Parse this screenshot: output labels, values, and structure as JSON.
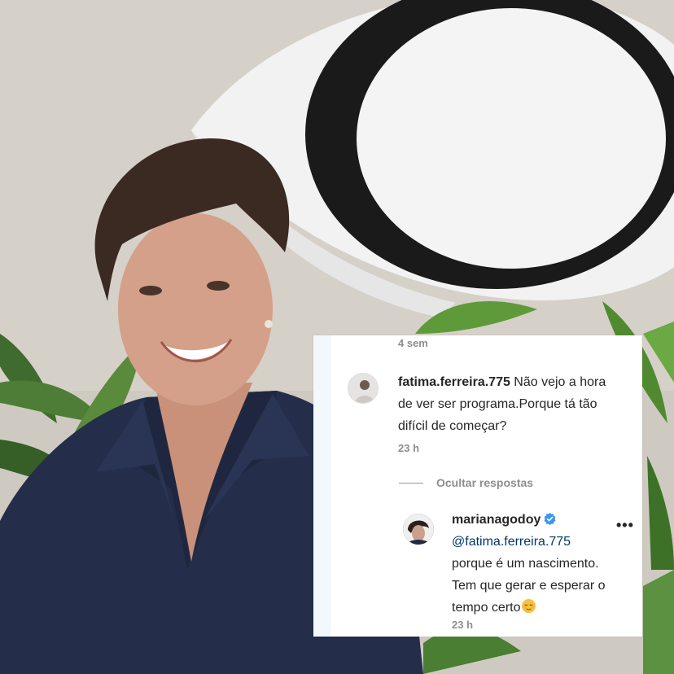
{
  "comments": {
    "top_timestamp": "4 sem",
    "first": {
      "username": "fatima.ferreira.775",
      "text": " Não vejo a hora de ver ser programa.Porque tá tão difícil de começar?",
      "timestamp": "23 h"
    },
    "hide_replies_label": "Ocultar respostas",
    "reply": {
      "username": "marianagodoy",
      "mention": "@fatima.ferreira.775",
      "text": "porque é um nascimento. Tem que gerar e esperar o tempo certo",
      "emoji": "relieved-face",
      "timestamp": "23 h",
      "more_label": "•••"
    }
  },
  "colors": {
    "verified_badge": "#3897f0",
    "mention": "#00376b",
    "secondary_text": "#8e8e8e",
    "dress": "#242d4a"
  }
}
